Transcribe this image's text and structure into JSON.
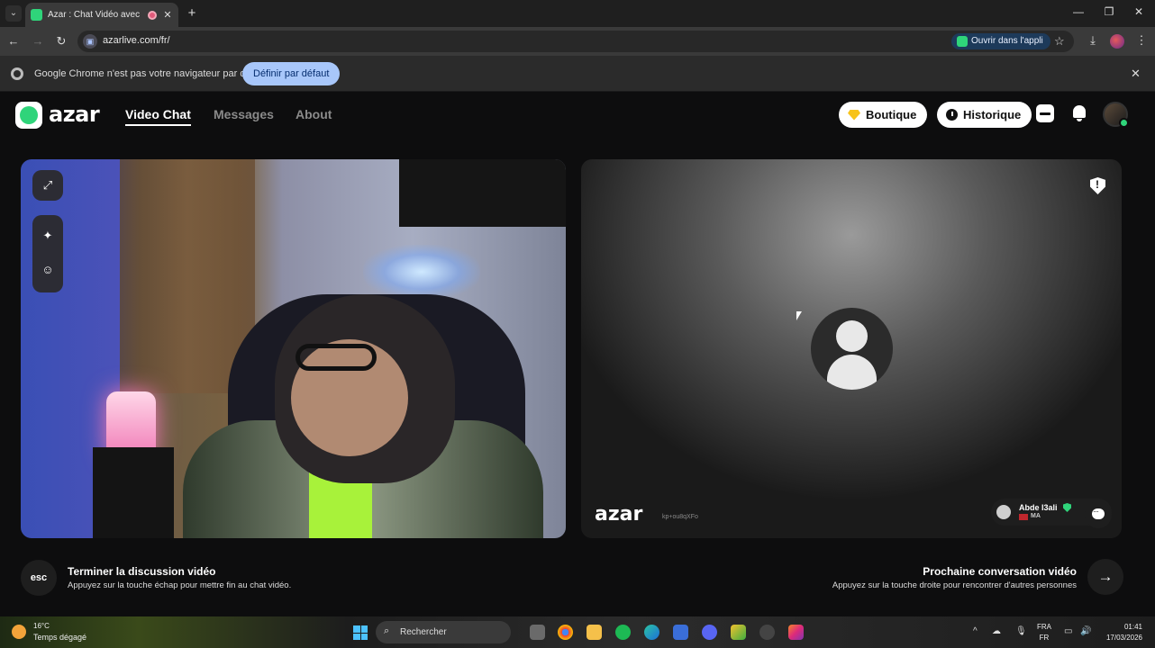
{
  "browser": {
    "tab_title": "Azar : Chat Vidéo avec de n",
    "url": "azarlive.com/fr/",
    "open_app_label": "Ouvrir dans l'appli",
    "infobar_text": "Google Chrome n'est pas votre navigateur par défaut",
    "infobar_button": "Définir par défaut"
  },
  "header": {
    "logo": "azar",
    "nav": [
      "Video Chat",
      "Messages",
      "About"
    ],
    "boutique_label": "Boutique",
    "historique_label": "Historique"
  },
  "remote": {
    "logo": "azar",
    "session_id": "kp+ou8qXFo",
    "user_name": "Abde l3ali",
    "user_country": "MA"
  },
  "hints": {
    "esc_key": "esc",
    "end_title": "Terminer la discussion vidéo",
    "end_sub": "Appuyez sur la touche échap pour mettre fin au chat vidéo.",
    "next_title": "Prochaine conversation vidéo",
    "next_sub": "Appuyez sur la touche droite pour rencontrer d'autres personnes",
    "next_arrow": "→"
  },
  "taskbar": {
    "weather_temp": "16°C",
    "weather_desc": "Temps dégagé",
    "search_placeholder": "Rechercher",
    "lang_top": "FRA",
    "lang_bottom": "FR",
    "time": "01:41",
    "date": "17/03/2026"
  },
  "colors": {
    "brand_green": "#2fd47a",
    "gem_gold": "#f7c31a",
    "infobar_button": "#a8c7fa"
  }
}
